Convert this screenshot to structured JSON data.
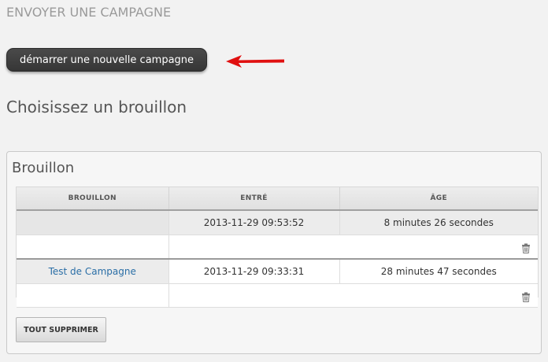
{
  "header": {
    "title": "ENVOYER UNE CAMPAGNE",
    "new_campaign_label": "démarrer une nouvelle campagne"
  },
  "section": {
    "title": "Choisissez un brouillon"
  },
  "panel": {
    "title": "Brouillon",
    "columns": [
      "BROUILLON",
      "ENTRÉ",
      "ÂGE"
    ],
    "rows": [
      {
        "name": "",
        "entered": "2013-11-29 09:53:52",
        "age": "8 minutes 26 secondes"
      },
      {
        "name": "Test de Campagne",
        "entered": "2013-11-29 09:33:31",
        "age": "28 minutes 47 secondes"
      }
    ],
    "delete_all_label": "TOUT SUPPRIMER"
  },
  "icons": {
    "arrow": "red-arrow-icon",
    "trash": "trash-icon"
  },
  "colors": {
    "button_dark": "#3d3d3d",
    "link": "#2a6ea6",
    "arrow": "#e01010"
  }
}
